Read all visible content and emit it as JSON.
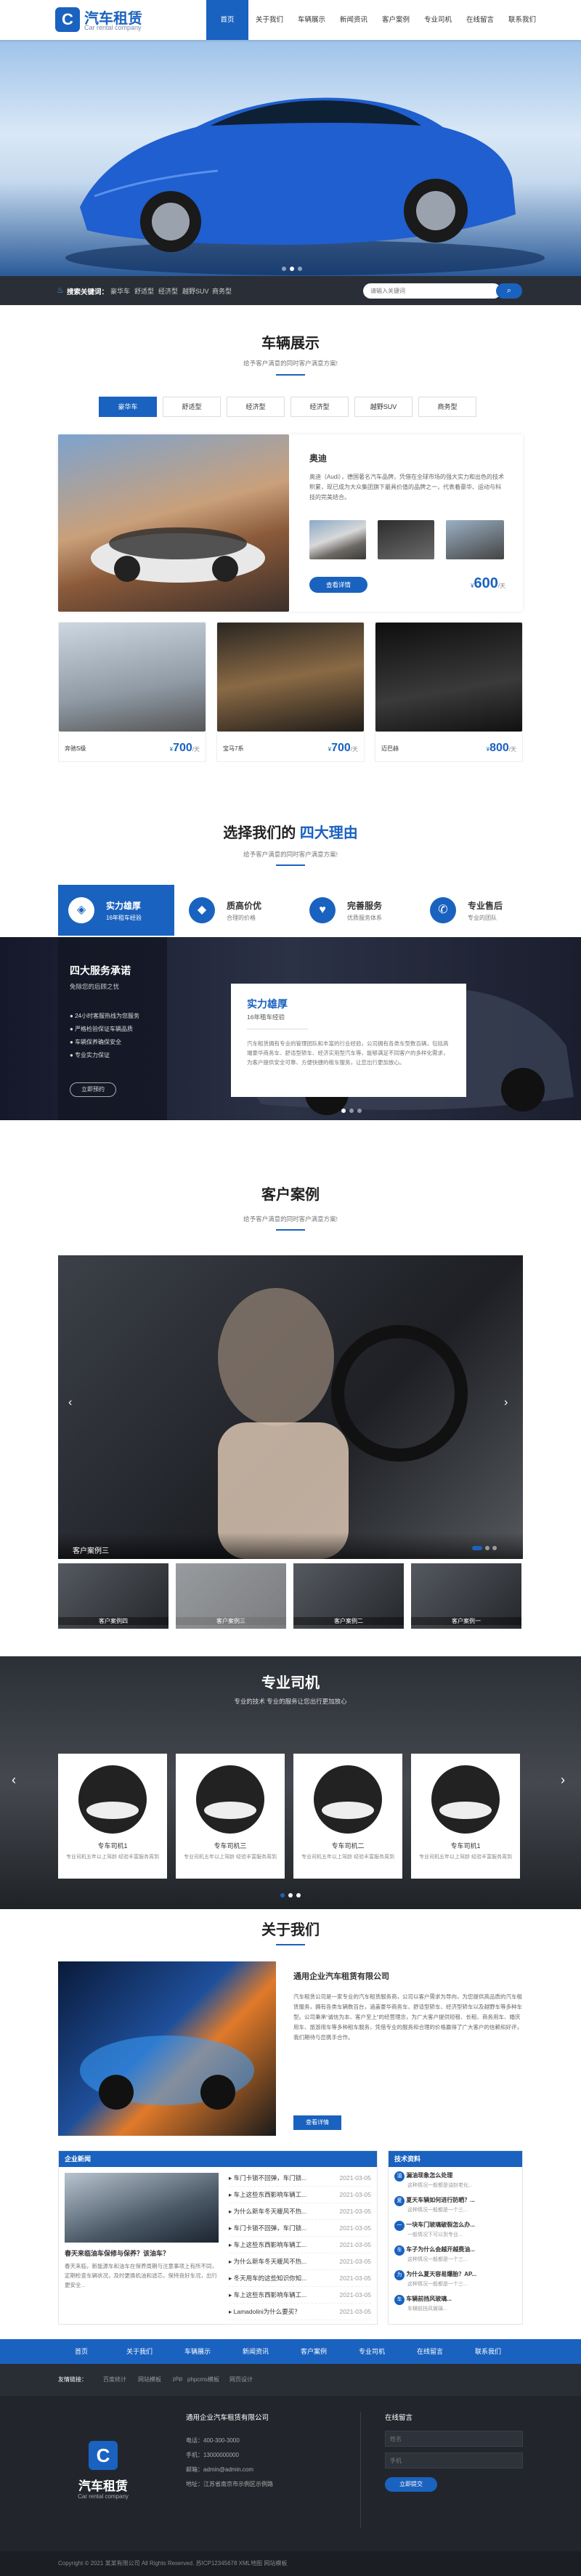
{
  "header": {
    "logo_char": "C",
    "brand": "汽车租赁",
    "brand_sub": "Car rental company",
    "nav": [
      "首页",
      "关于我们",
      "车辆展示",
      "新闻资讯",
      "客户案例",
      "专业司机",
      "在线留言",
      "联系我们"
    ]
  },
  "search": {
    "label": "搜索关键词：",
    "keywords": [
      "豪华车",
      "舒适型",
      "经济型",
      "越野SUV",
      "商务型"
    ],
    "placeholder": "请输入关键词"
  },
  "vehicles": {
    "title": "车辆展示",
    "subtitle": "给予客户满意的同时客户满意方案!",
    "tabs": [
      "豪华车",
      "舒适型",
      "经济型",
      "经济型",
      "越野SUV",
      "商务型"
    ],
    "featured": {
      "name": "奥迪",
      "desc": "奥迪（Audi），德国著名汽车品牌，凭借在全球市场的强大实力和出色的技术积累，现已成为大众集团旗下最具价值的品牌之一，代表着豪华、运动与科技的完美结合。",
      "btn": "查看详情",
      "price_symbol": "¥",
      "price": "600",
      "unit": "/天"
    },
    "cards": [
      {
        "name": "奔驰S级",
        "price": "700"
      },
      {
        "name": "宝马7系",
        "price": "700"
      },
      {
        "name": "迈巴赫",
        "price": "800"
      }
    ]
  },
  "reasons": {
    "title_a": "选择我们的",
    "title_b": "四大理由",
    "subtitle": "给予客户满意的同时客户满意方案!",
    "items": [
      {
        "title": "实力雄厚",
        "sub": "16年租车经验",
        "icon": "◈"
      },
      {
        "title": "质高价优",
        "sub": "合理的价格",
        "icon": "◆"
      },
      {
        "title": "完善服务",
        "sub": "优质服务体系",
        "icon": "♥"
      },
      {
        "title": "专业售后",
        "sub": "专业的团队",
        "icon": "✆"
      }
    ],
    "promise_title": "四大服务承诺",
    "promise_sub": "免除您的后顾之忧",
    "promise_list": [
      "24小时客服热线为您服务",
      "严格检验保证车辆品质",
      "车辆保养确保安全",
      "专业实力保证"
    ],
    "promise_btn": "立即预约",
    "card_title": "实力雄厚",
    "card_sub": "16年租车经验",
    "card_text": "汽车租赁拥有专业的管理团队和丰富的行业经验，公司拥有各类车型数百辆，包括高端豪华商务车、舒适型轿车、经济实用型汽车等，能够满足不同客户的多样化需求，为客户提供安全可靠、方便快捷的租车服务，让您出行更加放心。"
  },
  "cases": {
    "title": "客户案例",
    "subtitle": "给予客户满意的同时客户满意方案!",
    "caption": "客户案例三",
    "thumbs": [
      "客户案例四",
      "客户案例三",
      "客户案例二",
      "客户案例一"
    ]
  },
  "drivers": {
    "title": "专业司机",
    "subtitle": "专业的技术 专业的服务让您出行更加放心",
    "cards": [
      {
        "name": "专车司机1",
        "desc": "专业司机五年以上驾龄 经验丰富服务周到"
      },
      {
        "name": "专车司机三",
        "desc": "专业司机五年以上驾龄 经验丰富服务周到"
      },
      {
        "name": "专车司机二",
        "desc": "专业司机五年以上驾龄 经验丰富服务周到"
      },
      {
        "name": "专车司机1",
        "desc": "专业司机五年以上驾龄 经验丰富服务周到"
      }
    ],
    "btn": "查看详情"
  },
  "about": {
    "title": "关于我们",
    "company": "通用企业汽车租赁有限公司",
    "text": "汽车租赁公司是一家专业的汽车租赁服务商，公司以客户需求为导向，为您提供高品质的汽车租赁服务，拥有各类车辆数百台，涵盖豪华商务车、舒适型轿车、经济型轿车以及越野车等多种车型。公司秉承“诚信为本、客户至上”的经营理念，为广大客户提供短租、长租、商务用车、婚庆用车、旅游用车等多种租车服务，凭借专业的服务和合理的价格赢得了广大客户的信赖和好评，我们期待与您携手合作。",
    "btn": "查看详情"
  },
  "news": {
    "left_title": "企业新闻",
    "featured_title": "春天来临油车保修与保养？该油车？",
    "featured_text": "春天来临，新能源车和油车在保养周期与注意事项上有所不同，定期检查车辆状况，及时更换机油和滤芯，保持良好车况，出行更安全...",
    "list": [
      {
        "t": "车门卡锁不回弹，车门锁...",
        "d": "2021-03-05"
      },
      {
        "t": "车上这些东西影响车辆工...",
        "d": "2021-03-05"
      },
      {
        "t": "为什么新车冬天暖风不热...",
        "d": "2021-03-05"
      },
      {
        "t": "车门卡锁不回弹，车门锁...",
        "d": "2021-03-05"
      },
      {
        "t": "车上这些东西影响车辆工...",
        "d": "2021-03-05"
      },
      {
        "t": "为什么新车冬天暖风不热...",
        "d": "2021-03-05"
      },
      {
        "t": "冬天用车的这些知识你知...",
        "d": "2021-03-05"
      },
      {
        "t": "车上这些东西影响车辆工...",
        "d": "2021-03-05"
      },
      {
        "t": "Lamadolini为什么要买？",
        "d": "2021-03-05"
      }
    ],
    "right_title": "技术资料",
    "right_items": [
      {
        "q": "油",
        "t": "漏油现象怎么处理",
        "s": "这种情况一般都是油封老化..."
      },
      {
        "q": "夏",
        "t": "夏天车辆如何进行防晒？...",
        "s": "这种情况一般都是一个三..."
      },
      {
        "q": "一",
        "t": "一块车门玻璃破裂怎么办...",
        "s": "一般情况下可以到专业..."
      },
      {
        "q": "车",
        "t": "车子为什么会越开越费油...",
        "s": "这种情况一般都是一个三..."
      },
      {
        "q": "为",
        "t": "为什么夏天容易爆胎？AP...",
        "s": "这种情况一般都是一个三..."
      },
      {
        "q": "车",
        "t": "车辆前挡风玻璃...",
        "s": "车辆前挡风玻璃..."
      }
    ]
  },
  "footnav": [
    "首页",
    "关于我们",
    "车辆展示",
    "新闻资讯",
    "客户案例",
    "专业司机",
    "在线留言",
    "联系我们"
  ],
  "links": {
    "label": "友情链接：",
    "items": [
      "百度统计",
      "网站模板",
      "php",
      "phpcms模板",
      "网页设计"
    ]
  },
  "footer": {
    "logo_char": "C",
    "brand": "汽车租赁",
    "brand_sub": "Car rental company",
    "company": "通用企业汽车租赁有限公司",
    "tel_label": "电话：",
    "tel": "400-300-3000",
    "phone_label": "手机：",
    "phone": "13000000000",
    "email_label": "邮箱：",
    "email": "admin@admin.com",
    "addr_label": "地址：",
    "addr": "江苏省南京市示例区示例路",
    "msg_title": "在线留言",
    "msg_name_ph": "姓名",
    "msg_phone_ph": "手机",
    "msg_btn": "立即提交"
  },
  "copyright": "Copyright © 2021 某某有限公司 All Rights Reserved. 苏ICP12345678 XML地图 网站模板",
  "colors": {
    "primary": "#1a62bf",
    "dark": "#22262c"
  }
}
